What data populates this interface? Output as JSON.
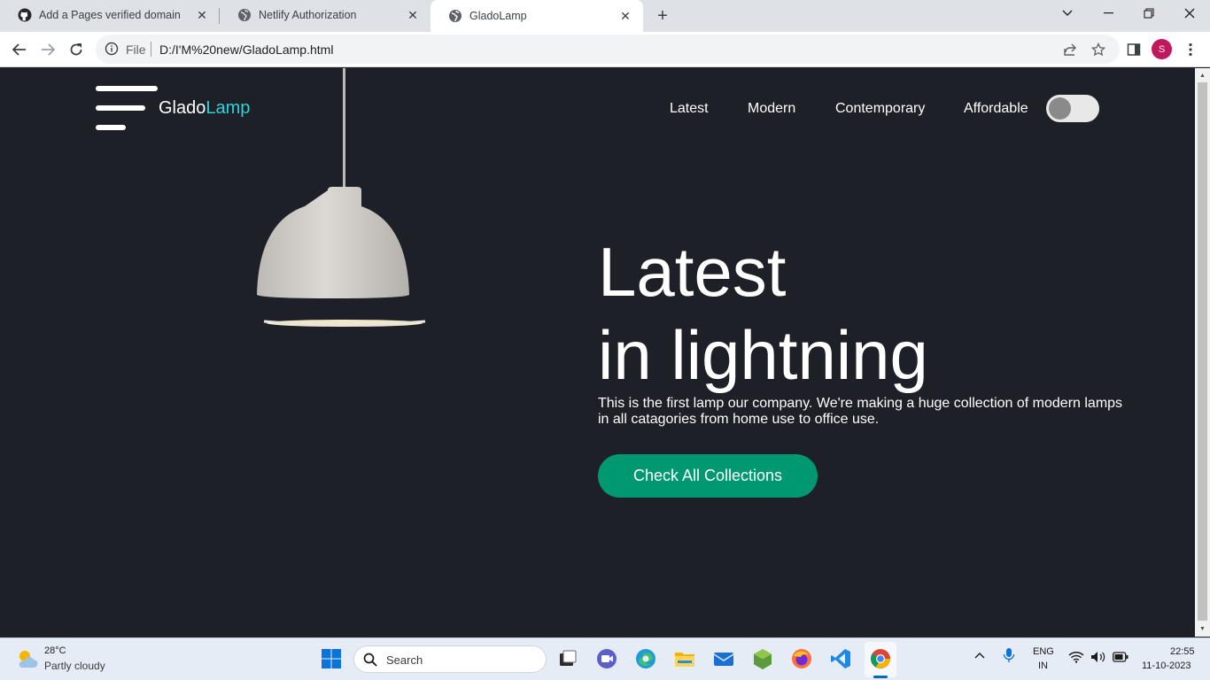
{
  "browser": {
    "tabs": [
      {
        "title": "Add a Pages verified domain",
        "icon": "github-icon",
        "active": false
      },
      {
        "title": "Netlify Authorization",
        "icon": "globe-icon",
        "active": false
      },
      {
        "title": "GladoLamp",
        "icon": "globe-icon",
        "active": true
      }
    ],
    "omnibox": {
      "scheme_label": "File",
      "url": "D:/I'M%20new/GladoLamp.html"
    },
    "profile_initial": "S"
  },
  "site": {
    "brand": {
      "part1": "Glado",
      "part2": "Lamp"
    },
    "nav": [
      "Latest",
      "Modern",
      "Contemporary",
      "Affordable"
    ],
    "theme_toggle": {
      "on": false
    },
    "hero": {
      "line1": "Latest",
      "line2": "in lightning",
      "description_line1": "This is the first lamp our company. We're making a huge collection of modern lamps",
      "description_line2": "in all catagories from home use to office use.",
      "cta": "Check All Collections"
    },
    "colors": {
      "background": "#1e2027",
      "accent": "#2ed3d9",
      "cta": "#009870"
    }
  },
  "taskbar": {
    "weather": {
      "temp": "28°C",
      "desc": "Partly cloudy"
    },
    "search_placeholder": "Search",
    "lang": {
      "line1": "ENG",
      "line2": "IN"
    },
    "clock": {
      "time": "22:55",
      "date": "11-10-2023"
    },
    "apps": [
      "windows-start-icon",
      "search-icon",
      "task-view-icon",
      "meet-icon",
      "edge-icon",
      "file-explorer-icon",
      "mail-icon",
      "nodejs-icon",
      "firefox-icon",
      "vscode-icon",
      "chrome-icon"
    ]
  }
}
